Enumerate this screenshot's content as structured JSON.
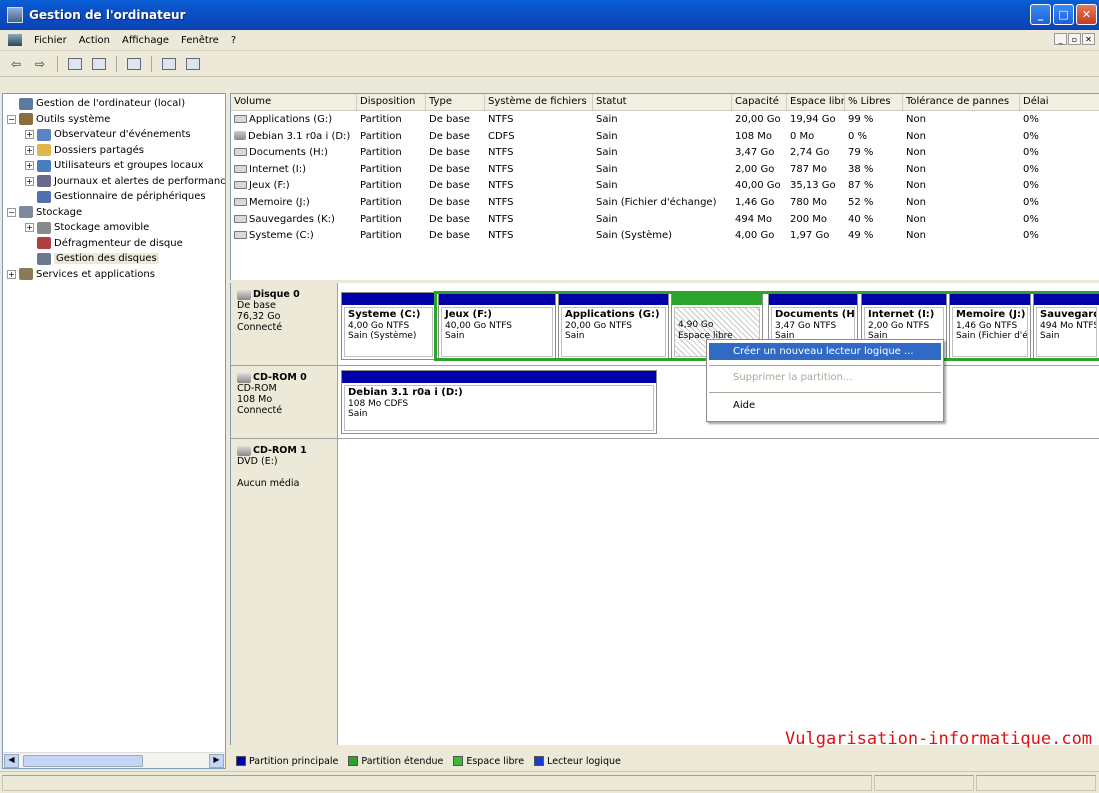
{
  "window": {
    "title": "Gestion de l'ordinateur",
    "min": "_",
    "max": "□",
    "close": "✕"
  },
  "menu": [
    "Fichier",
    "Action",
    "Affichage",
    "Fenêtre",
    "?"
  ],
  "mdi": [
    "_",
    "▫",
    "✕"
  ],
  "tree": [
    {
      "label": "Gestion de l'ordinateur (local)",
      "level": 0,
      "exp": "",
      "color": "#5a7aa0"
    },
    {
      "label": "Outils système",
      "level": 0,
      "exp": "−",
      "color": "#8c6e3c"
    },
    {
      "label": "Observateur d'événements",
      "level": 1,
      "exp": "+",
      "color": "#5b84c4"
    },
    {
      "label": "Dossiers partagés",
      "level": 1,
      "exp": "+",
      "color": "#e0b84a"
    },
    {
      "label": "Utilisateurs et groupes locaux",
      "level": 1,
      "exp": "+",
      "color": "#4a7cc0"
    },
    {
      "label": "Journaux et alertes de performance",
      "level": 1,
      "exp": "+",
      "color": "#6a6a8a"
    },
    {
      "label": "Gestionnaire de périphériques",
      "level": 1,
      "exp": "",
      "color": "#5070b0"
    },
    {
      "label": "Stockage",
      "level": 0,
      "exp": "−",
      "color": "#7a8a9a"
    },
    {
      "label": "Stockage amovible",
      "level": 1,
      "exp": "+",
      "color": "#8a8a8a"
    },
    {
      "label": "Défragmenteur de disque",
      "level": 1,
      "exp": "",
      "color": "#b04040"
    },
    {
      "label": "Gestion des disques",
      "level": 1,
      "exp": "",
      "color": "#6a7a8a",
      "selected": true
    },
    {
      "label": "Services et applications",
      "level": 0,
      "exp": "+",
      "color": "#8a7a5a"
    }
  ],
  "columns": [
    "Volume",
    "Disposition",
    "Type",
    "Système de fichiers",
    "Statut",
    "Capacité",
    "Espace libre",
    "% Libres",
    "Tolérance de pannes",
    "Délai"
  ],
  "volumes": [
    {
      "icon": "drive",
      "cells": [
        "Applications (G:)",
        "Partition",
        "De base",
        "NTFS",
        "Sain",
        "20,00 Go",
        "19,94 Go",
        "99 %",
        "Non",
        "0%"
      ]
    },
    {
      "icon": "cdrom",
      "cells": [
        "Debian 3.1 r0a i (D:)",
        "Partition",
        "De base",
        "CDFS",
        "Sain",
        "108 Mo",
        "0 Mo",
        "0 %",
        "Non",
        "0%"
      ]
    },
    {
      "icon": "drive",
      "cells": [
        "Documents (H:)",
        "Partition",
        "De base",
        "NTFS",
        "Sain",
        "3,47 Go",
        "2,74 Go",
        "79 %",
        "Non",
        "0%"
      ]
    },
    {
      "icon": "drive",
      "cells": [
        "Internet (I:)",
        "Partition",
        "De base",
        "NTFS",
        "Sain",
        "2,00 Go",
        "787 Mo",
        "38 %",
        "Non",
        "0%"
      ]
    },
    {
      "icon": "drive",
      "cells": [
        "Jeux (F:)",
        "Partition",
        "De base",
        "NTFS",
        "Sain",
        "40,00 Go",
        "35,13 Go",
        "87 %",
        "Non",
        "0%"
      ]
    },
    {
      "icon": "drive",
      "cells": [
        "Memoire (J:)",
        "Partition",
        "De base",
        "NTFS",
        "Sain (Fichier d'échange)",
        "1,46 Go",
        "780 Mo",
        "52 %",
        "Non",
        "0%"
      ]
    },
    {
      "icon": "drive",
      "cells": [
        "Sauvegardes (K:)",
        "Partition",
        "De base",
        "NTFS",
        "Sain",
        "494 Mo",
        "200 Mo",
        "40 %",
        "Non",
        "0%"
      ]
    },
    {
      "icon": "drive",
      "cells": [
        "Systeme (C:)",
        "Partition",
        "De base",
        "NTFS",
        "Sain (Système)",
        "4,00 Go",
        "1,97 Go",
        "49 %",
        "Non",
        "0%"
      ]
    }
  ],
  "disks": [
    {
      "name": "Disque 0",
      "lines": [
        "De base",
        "76,32 Go",
        "Connecté"
      ]
    },
    {
      "name": "CD-ROM 0",
      "lines": [
        "CD-ROM",
        "108 Mo",
        "Connecté"
      ]
    },
    {
      "name": "CD-ROM 1",
      "lines": [
        "DVD (E:)",
        "",
        "Aucun média"
      ]
    }
  ],
  "disk0_parts": [
    {
      "name": "Systeme (C:)",
      "l1": "4,00 Go NTFS",
      "l2": "Sain (Système)"
    },
    {
      "name": "Jeux (F:)",
      "l1": "40,00 Go NTFS",
      "l2": "Sain"
    },
    {
      "name": "Applications (G:)",
      "l1": "20,00 Go NTFS",
      "l2": "Sain"
    },
    {
      "name": "",
      "l1": "4,90 Go",
      "l2": "Espace libre"
    },
    {
      "name": "Documents (H:)",
      "l1": "3,47 Go NTFS",
      "l2": "Sain"
    },
    {
      "name": "Internet (I:)",
      "l1": "2,00 Go NTFS",
      "l2": "Sain"
    },
    {
      "name": "Memoire (J:)",
      "l1": "1,46 Go NTFS",
      "l2": "Sain (Fichier d'échange)"
    },
    {
      "name": "Sauvegardes (K:)",
      "l1": "494 Mo NTFS",
      "l2": "Sain"
    }
  ],
  "cdrom0_part": {
    "name": "Debian 3.1 r0a i  (D:)",
    "l1": "108 Mo CDFS",
    "l2": "Sain"
  },
  "context_menu": {
    "create": "Créer un nouveau lecteur logique ...",
    "delete": "Supprimer la partition...",
    "help": "Aide"
  },
  "legend": [
    {
      "label": "Partition principale",
      "color": "#0000a8"
    },
    {
      "label": "Partition étendue",
      "color": "#2aa52a"
    },
    {
      "label": "Espace libre",
      "color": "#3cb83c"
    },
    {
      "label": "Lecteur logique",
      "color": "#1a3ad0"
    }
  ],
  "watermark": "Vulgarisation-informatique.com"
}
